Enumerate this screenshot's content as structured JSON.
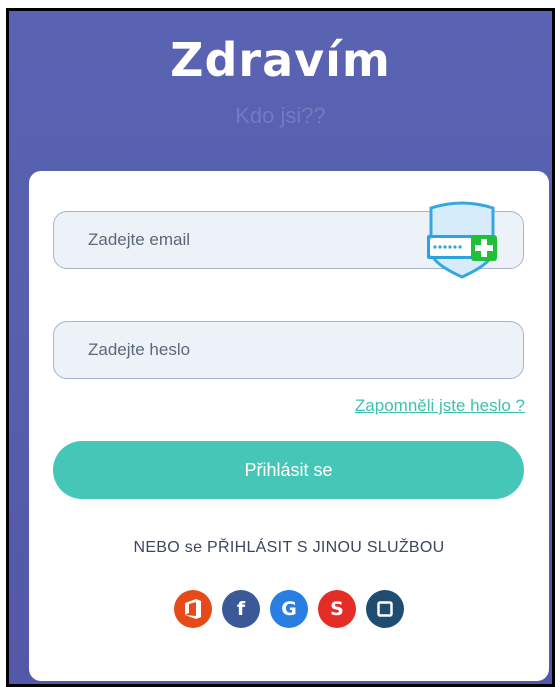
{
  "header": {
    "title": "Zdravím",
    "subtitle": "Kdo jsi??"
  },
  "form": {
    "email_placeholder": "Zadejte email",
    "password_placeholder": "Zadejte heslo",
    "forgot_link": "Zapomněli jste heslo ?",
    "login_button": "Přihlásit se",
    "alt_login_text": "NEBO se PŘIHLÁSIT S JINOU SLUŽBOU"
  },
  "social_logins": [
    {
      "name": "office",
      "icon": "office-icon",
      "color": "#e64a19"
    },
    {
      "name": "facebook",
      "icon": "facebook-icon",
      "color": "#3b5998",
      "glyph": "f"
    },
    {
      "name": "google",
      "icon": "google-icon",
      "color": "#2a7de1",
      "glyph": "G"
    },
    {
      "name": "s-service",
      "icon": "s-icon",
      "color": "#e52d27",
      "glyph": "S"
    },
    {
      "name": "square-service",
      "icon": "square-icon",
      "color": "#1f4c70"
    }
  ],
  "colors": {
    "background": "#5a63b3",
    "accent": "#45c6b7",
    "link": "#3fc0ae"
  }
}
